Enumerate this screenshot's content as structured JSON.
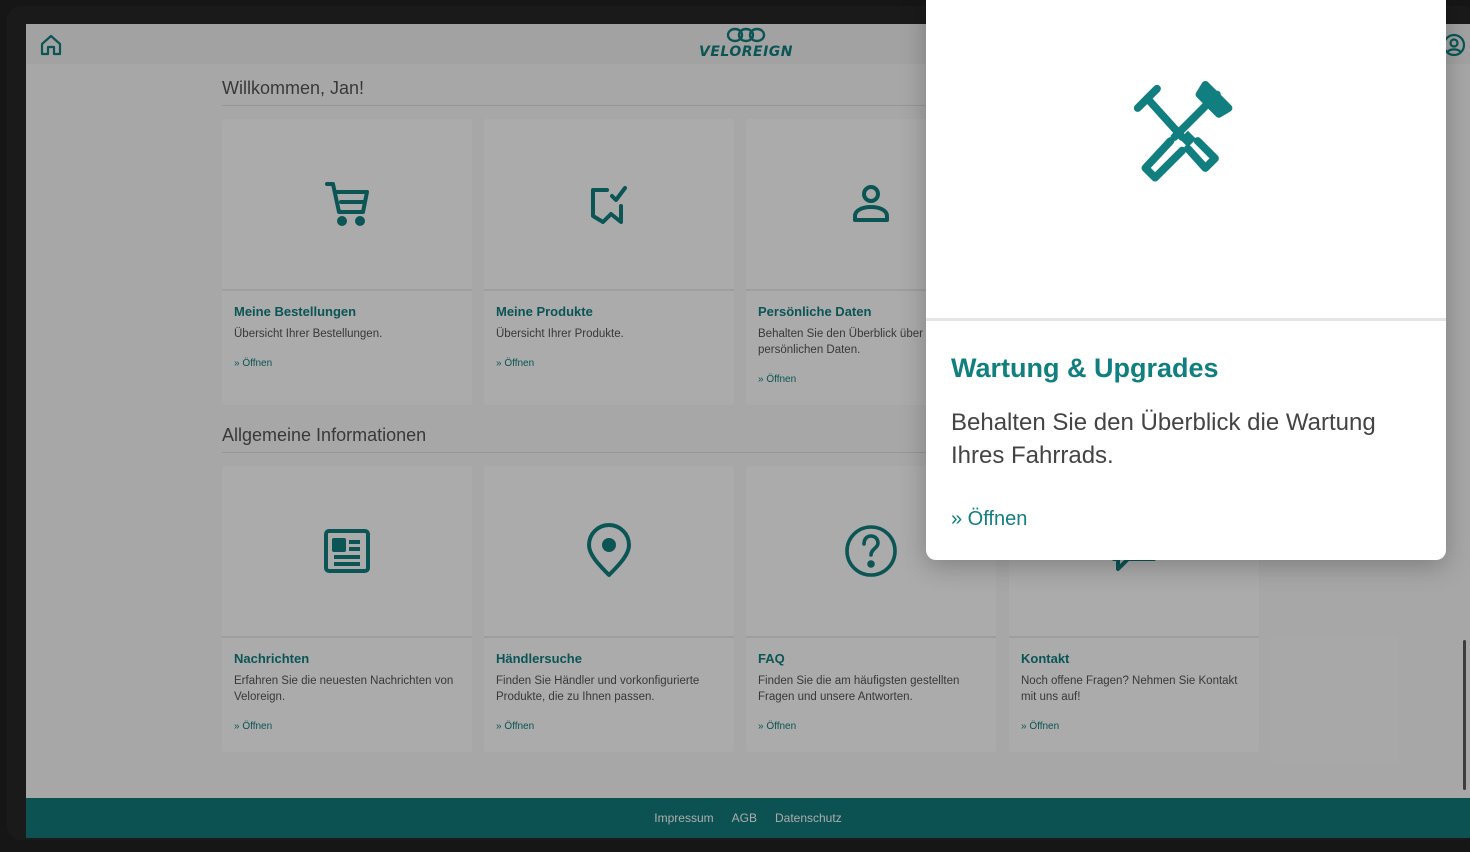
{
  "header": {
    "brand_name": "VELOREIGN",
    "home_icon": "home-icon",
    "profile_icon": "user-circle-icon"
  },
  "sections": [
    {
      "title": "Willkommen, Jan!",
      "cards": [
        {
          "icon": "cart-icon",
          "title": "Meine Bestellungen",
          "description": "Übersicht Ihrer Bestellungen.",
          "link": "» Öffnen"
        },
        {
          "icon": "bookmark-check-icon",
          "title": "Meine Produkte",
          "description": "Übersicht Ihrer Produkte.",
          "link": "» Öffnen"
        },
        {
          "icon": "person-icon",
          "title": "Persönliche Daten",
          "description": "Behalten Sie den Überblick über Ihre persönlichen Daten.",
          "link": "» Öffnen"
        }
      ]
    },
    {
      "title": "Allgemeine Informationen",
      "cards": [
        {
          "icon": "newspaper-icon",
          "title": "Nachrichten",
          "description": "Erfahren Sie die neuesten Nachrichten von Veloreign.",
          "link": "» Öffnen"
        },
        {
          "icon": "location-pin-icon",
          "title": "Händlersuche",
          "description": "Finden Sie Händler und vorkonfigurierte Produkte, die zu Ihnen passen.",
          "link": "» Öffnen"
        },
        {
          "icon": "question-circle-icon",
          "title": "FAQ",
          "description": "Finden Sie die am häufigsten gestellten Fragen und unsere Antworten.",
          "link": "» Öffnen"
        },
        {
          "icon": "chat-icon",
          "title": "Kontakt",
          "description": "Noch offene Fragen? Nehmen Sie Kontakt mit uns auf!",
          "link": "» Öffnen"
        }
      ]
    }
  ],
  "popup": {
    "icon": "tools-icon",
    "title": "Wartung & Upgrades",
    "description": "Behalten Sie den Überblick die Wartung Ihres Fahrrads.",
    "link": "» Öffnen"
  },
  "footer": {
    "links": [
      "Impressum",
      "AGB",
      "Datenschutz"
    ]
  },
  "colors": {
    "accent": "#117f7f",
    "footer": "#127b7b"
  }
}
